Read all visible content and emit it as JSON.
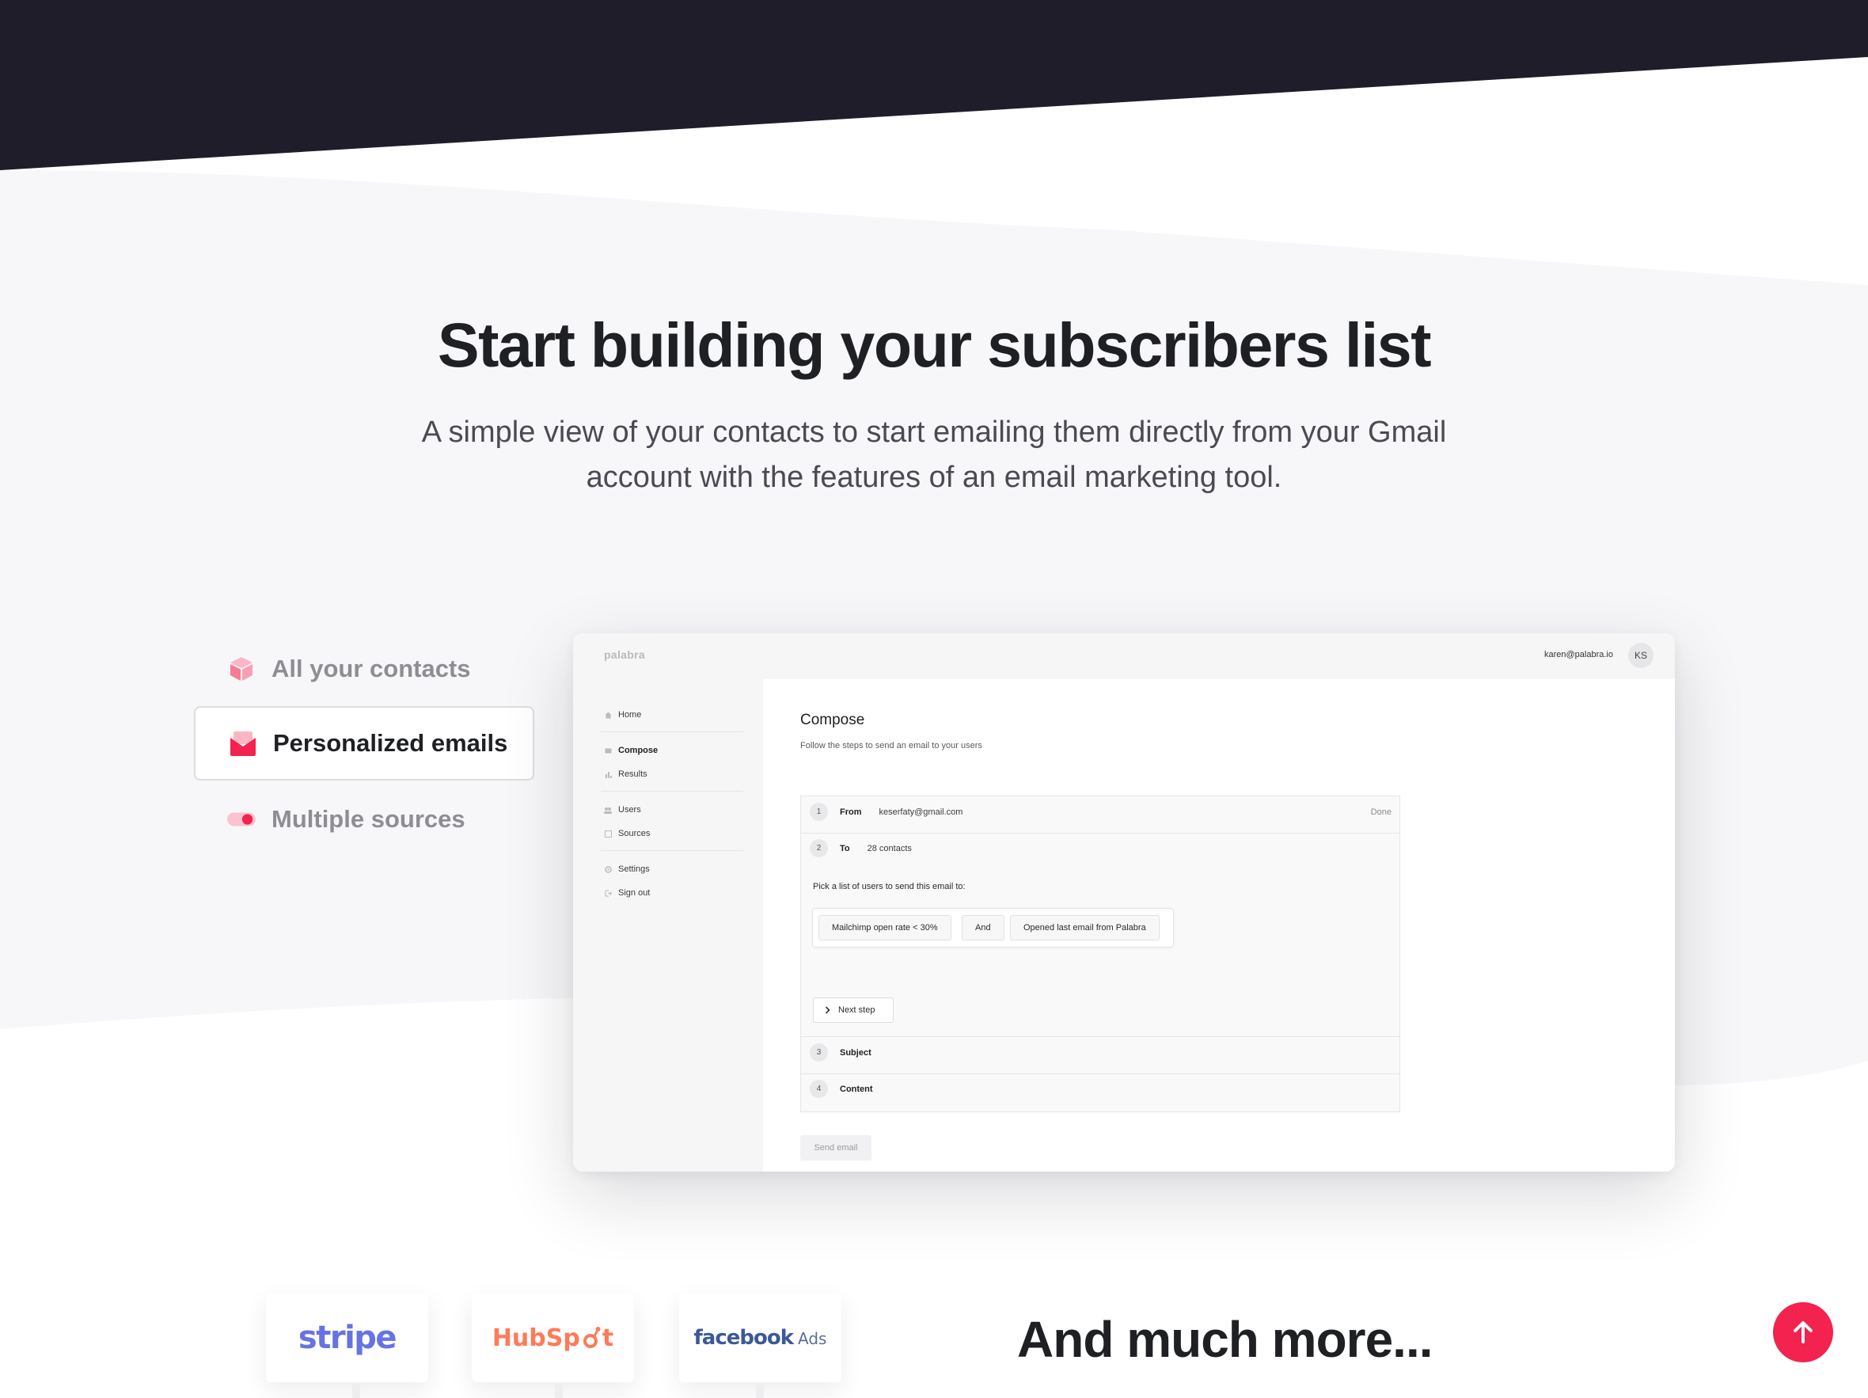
{
  "hero": {
    "title": "Start building your subscribers list",
    "subtitle": "A simple view of your contacts to start emailing them directly from your Gmail account with the features of an email marketing tool."
  },
  "features": [
    {
      "label": "All your contacts",
      "icon": "cube-icon",
      "active": false
    },
    {
      "label": "Personalized emails",
      "icon": "envelope-icon",
      "active": true
    },
    {
      "label": "Multiple sources",
      "icon": "toggle-icon",
      "active": false
    }
  ],
  "app": {
    "brand": "palabra",
    "user_email": "karen@palabra.io",
    "avatar_initials": "KS",
    "nav": {
      "home": "Home",
      "compose": "Compose",
      "results": "Results",
      "users": "Users",
      "sources": "Sources",
      "settings": "Settings",
      "sign_out": "Sign out"
    },
    "compose": {
      "title": "Compose",
      "subtitle": "Follow the steps to send an email to your users",
      "steps": [
        {
          "num": "1",
          "label": "From",
          "value": "keserfaty@gmail.com",
          "status": "Done"
        },
        {
          "num": "2",
          "label": "To",
          "value": "28 contacts"
        },
        {
          "num": "3",
          "label": "Subject"
        },
        {
          "num": "4",
          "label": "Content"
        }
      ],
      "pick_text": "Pick a list of users to send this email to:",
      "chips": [
        "Mailchimp open rate < 30%",
        "And",
        "Opened last email from Palabra"
      ],
      "next_step": "Next step",
      "send_email": "Send email"
    }
  },
  "integrations": {
    "logos": [
      {
        "name": "stripe",
        "text": "stripe",
        "color": "#6772e5"
      },
      {
        "name": "hubspot",
        "text_left": "HubSp",
        "text_right": "t",
        "color": "#ff7a59"
      },
      {
        "name": "facebook-ads",
        "text_main": "facebook",
        "text_sub": "Ads",
        "color": "#3b5998"
      }
    ],
    "more_title": "And much more..."
  },
  "colors": {
    "dark_header": "#1e1d29",
    "light_band": "#f7f7f9",
    "accent": "#f3224e",
    "text_dark": "#1f2024",
    "text_muted": "#8d8e93"
  }
}
